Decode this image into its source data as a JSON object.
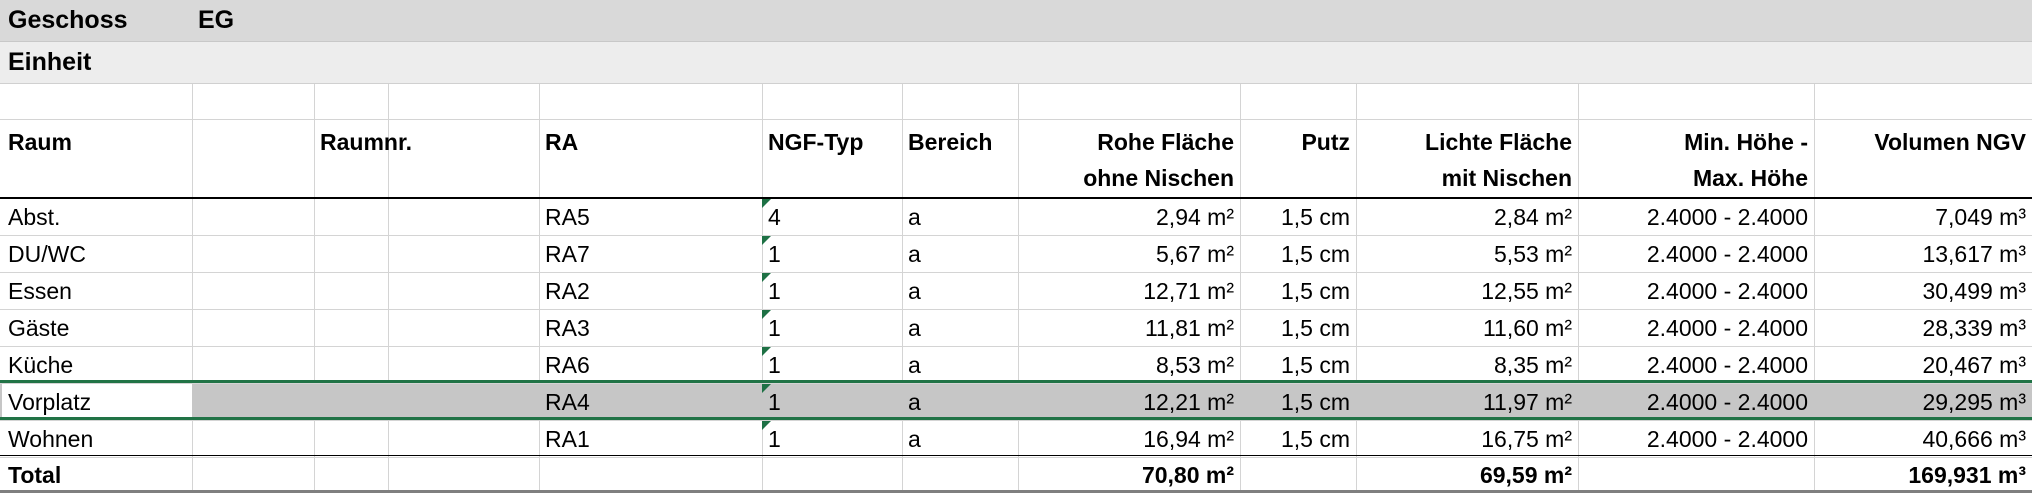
{
  "geschoss": {
    "label": "Geschoss",
    "value": "EG"
  },
  "einheit": {
    "label": "Einheit"
  },
  "headers": {
    "raum": "Raum",
    "raumnr": "Raumnr.",
    "ra": "RA",
    "ngf_typ": "NGF-Typ",
    "bereich": "Bereich",
    "rohe_flaeche_1": "Rohe Fläche",
    "rohe_flaeche_2": "ohne Nischen",
    "putz": "Putz",
    "lichte_flaeche_1": "Lichte Fläche",
    "lichte_flaeche_2": "mit Nischen",
    "hoehe_1": "Min. Höhe -",
    "hoehe_2": "Max. Höhe",
    "volumen": "Volumen NGV"
  },
  "rows": [
    {
      "raum": "Abst.",
      "raumnr": "",
      "ra": "RA5",
      "ngf_typ": "4",
      "bereich": "a",
      "rohe": "2,94 m²",
      "putz": "1,5 cm",
      "lichte": "2,84 m²",
      "hoehe": "2.4000 - 2.4000",
      "volumen": "7,049 m³"
    },
    {
      "raum": "DU/WC",
      "raumnr": "",
      "ra": "RA7",
      "ngf_typ": "1",
      "bereich": "a",
      "rohe": "5,67 m²",
      "putz": "1,5 cm",
      "lichte": "5,53 m²",
      "hoehe": "2.4000 - 2.4000",
      "volumen": "13,617 m³"
    },
    {
      "raum": "Essen",
      "raumnr": "",
      "ra": "RA2",
      "ngf_typ": "1",
      "bereich": "a",
      "rohe": "12,71 m²",
      "putz": "1,5 cm",
      "lichte": "12,55 m²",
      "hoehe": "2.4000 - 2.4000",
      "volumen": "30,499 m³"
    },
    {
      "raum": "Gäste",
      "raumnr": "",
      "ra": "RA3",
      "ngf_typ": "1",
      "bereich": "a",
      "rohe": "11,81 m²",
      "putz": "1,5 cm",
      "lichte": "11,60 m²",
      "hoehe": "2.4000 - 2.4000",
      "volumen": "28,339 m³"
    },
    {
      "raum": "Küche",
      "raumnr": "",
      "ra": "RA6",
      "ngf_typ": "1",
      "bereich": "a",
      "rohe": "8,53 m²",
      "putz": "1,5 cm",
      "lichte": "8,35 m²",
      "hoehe": "2.4000 - 2.4000",
      "volumen": "20,467 m³"
    },
    {
      "raum": "Vorplatz",
      "raumnr": "",
      "ra": "RA4",
      "ngf_typ": "1",
      "bereich": "a",
      "rohe": "12,21 m²",
      "putz": "1,5 cm",
      "lichte": "11,97 m²",
      "hoehe": "2.4000 - 2.4000",
      "volumen": "29,295 m³"
    },
    {
      "raum": "Wohnen",
      "raumnr": "",
      "ra": "RA1",
      "ngf_typ": "1",
      "bereich": "a",
      "rohe": "16,94 m²",
      "putz": "1,5 cm",
      "lichte": "16,75 m²",
      "hoehe": "2.4000 - 2.4000",
      "volumen": "40,666 m³"
    }
  ],
  "total": {
    "label": "Total",
    "rohe": "70,80 m²",
    "lichte": "69,59 m²",
    "volumen": "169,931 m³"
  },
  "colors": {
    "selection_border": "#217346",
    "selected_fill": "#c6c6c6",
    "error_flag": "#1e7145"
  }
}
